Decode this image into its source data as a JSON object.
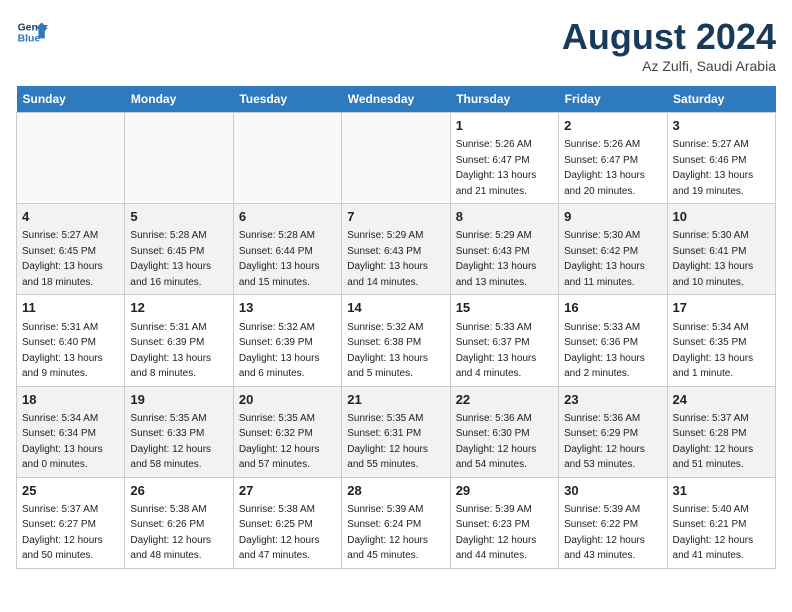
{
  "header": {
    "logo_line1": "General",
    "logo_line2": "Blue",
    "month": "August 2024",
    "location": "Az Zulfi, Saudi Arabia"
  },
  "weekdays": [
    "Sunday",
    "Monday",
    "Tuesday",
    "Wednesday",
    "Thursday",
    "Friday",
    "Saturday"
  ],
  "weeks": [
    [
      {
        "day": "",
        "info": ""
      },
      {
        "day": "",
        "info": ""
      },
      {
        "day": "",
        "info": ""
      },
      {
        "day": "",
        "info": ""
      },
      {
        "day": "1",
        "info": "Sunrise: 5:26 AM\nSunset: 6:47 PM\nDaylight: 13 hours\nand 21 minutes."
      },
      {
        "day": "2",
        "info": "Sunrise: 5:26 AM\nSunset: 6:47 PM\nDaylight: 13 hours\nand 20 minutes."
      },
      {
        "day": "3",
        "info": "Sunrise: 5:27 AM\nSunset: 6:46 PM\nDaylight: 13 hours\nand 19 minutes."
      }
    ],
    [
      {
        "day": "4",
        "info": "Sunrise: 5:27 AM\nSunset: 6:45 PM\nDaylight: 13 hours\nand 18 minutes."
      },
      {
        "day": "5",
        "info": "Sunrise: 5:28 AM\nSunset: 6:45 PM\nDaylight: 13 hours\nand 16 minutes."
      },
      {
        "day": "6",
        "info": "Sunrise: 5:28 AM\nSunset: 6:44 PM\nDaylight: 13 hours\nand 15 minutes."
      },
      {
        "day": "7",
        "info": "Sunrise: 5:29 AM\nSunset: 6:43 PM\nDaylight: 13 hours\nand 14 minutes."
      },
      {
        "day": "8",
        "info": "Sunrise: 5:29 AM\nSunset: 6:43 PM\nDaylight: 13 hours\nand 13 minutes."
      },
      {
        "day": "9",
        "info": "Sunrise: 5:30 AM\nSunset: 6:42 PM\nDaylight: 13 hours\nand 11 minutes."
      },
      {
        "day": "10",
        "info": "Sunrise: 5:30 AM\nSunset: 6:41 PM\nDaylight: 13 hours\nand 10 minutes."
      }
    ],
    [
      {
        "day": "11",
        "info": "Sunrise: 5:31 AM\nSunset: 6:40 PM\nDaylight: 13 hours\nand 9 minutes."
      },
      {
        "day": "12",
        "info": "Sunrise: 5:31 AM\nSunset: 6:39 PM\nDaylight: 13 hours\nand 8 minutes."
      },
      {
        "day": "13",
        "info": "Sunrise: 5:32 AM\nSunset: 6:39 PM\nDaylight: 13 hours\nand 6 minutes."
      },
      {
        "day": "14",
        "info": "Sunrise: 5:32 AM\nSunset: 6:38 PM\nDaylight: 13 hours\nand 5 minutes."
      },
      {
        "day": "15",
        "info": "Sunrise: 5:33 AM\nSunset: 6:37 PM\nDaylight: 13 hours\nand 4 minutes."
      },
      {
        "day": "16",
        "info": "Sunrise: 5:33 AM\nSunset: 6:36 PM\nDaylight: 13 hours\nand 2 minutes."
      },
      {
        "day": "17",
        "info": "Sunrise: 5:34 AM\nSunset: 6:35 PM\nDaylight: 13 hours\nand 1 minute."
      }
    ],
    [
      {
        "day": "18",
        "info": "Sunrise: 5:34 AM\nSunset: 6:34 PM\nDaylight: 13 hours\nand 0 minutes."
      },
      {
        "day": "19",
        "info": "Sunrise: 5:35 AM\nSunset: 6:33 PM\nDaylight: 12 hours\nand 58 minutes."
      },
      {
        "day": "20",
        "info": "Sunrise: 5:35 AM\nSunset: 6:32 PM\nDaylight: 12 hours\nand 57 minutes."
      },
      {
        "day": "21",
        "info": "Sunrise: 5:35 AM\nSunset: 6:31 PM\nDaylight: 12 hours\nand 55 minutes."
      },
      {
        "day": "22",
        "info": "Sunrise: 5:36 AM\nSunset: 6:30 PM\nDaylight: 12 hours\nand 54 minutes."
      },
      {
        "day": "23",
        "info": "Sunrise: 5:36 AM\nSunset: 6:29 PM\nDaylight: 12 hours\nand 53 minutes."
      },
      {
        "day": "24",
        "info": "Sunrise: 5:37 AM\nSunset: 6:28 PM\nDaylight: 12 hours\nand 51 minutes."
      }
    ],
    [
      {
        "day": "25",
        "info": "Sunrise: 5:37 AM\nSunset: 6:27 PM\nDaylight: 12 hours\nand 50 minutes."
      },
      {
        "day": "26",
        "info": "Sunrise: 5:38 AM\nSunset: 6:26 PM\nDaylight: 12 hours\nand 48 minutes."
      },
      {
        "day": "27",
        "info": "Sunrise: 5:38 AM\nSunset: 6:25 PM\nDaylight: 12 hours\nand 47 minutes."
      },
      {
        "day": "28",
        "info": "Sunrise: 5:39 AM\nSunset: 6:24 PM\nDaylight: 12 hours\nand 45 minutes."
      },
      {
        "day": "29",
        "info": "Sunrise: 5:39 AM\nSunset: 6:23 PM\nDaylight: 12 hours\nand 44 minutes."
      },
      {
        "day": "30",
        "info": "Sunrise: 5:39 AM\nSunset: 6:22 PM\nDaylight: 12 hours\nand 43 minutes."
      },
      {
        "day": "31",
        "info": "Sunrise: 5:40 AM\nSunset: 6:21 PM\nDaylight: 12 hours\nand 41 minutes."
      }
    ]
  ]
}
